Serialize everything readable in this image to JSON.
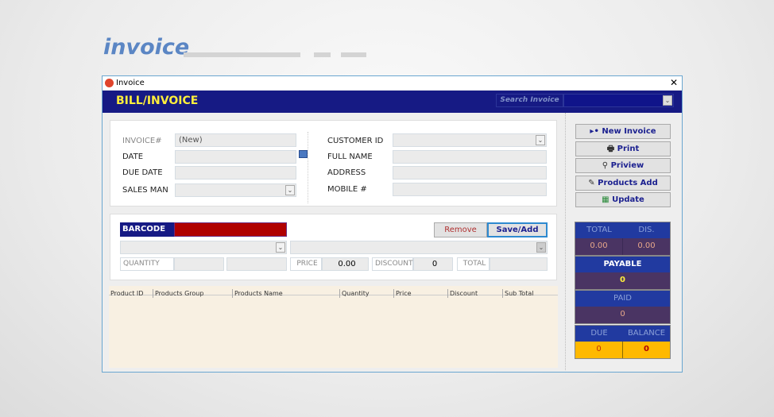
{
  "brand": {
    "title": "invoice"
  },
  "window": {
    "title": "Invoice",
    "close": "✕"
  },
  "header": {
    "title": "BILL/INVOICE",
    "search_label": "Search Invoice",
    "search_value": ""
  },
  "form": {
    "invoice_label": "INVOICE#",
    "invoice_value": "(New)",
    "date_label": "DATE",
    "due_date_label": "DUE DATE",
    "sales_man_label": "SALES MAN",
    "customer_id_label": "CUSTOMER ID",
    "full_name_label": "FULL NAME",
    "address_label": "ADDRESS",
    "mobile_label": "MOBILE #"
  },
  "item": {
    "barcode_label": "BARCODE",
    "remove": "Remove",
    "save_add": "Save/Add",
    "quantity_label": "QUANTITY",
    "price_label": "PRICE",
    "price_value": "0.00",
    "discount_label": "DISCOUNT",
    "discount_value": "0",
    "total_label": "TOTAL"
  },
  "grid": {
    "columns": [
      "Product ID",
      "Products Group",
      "Products Name",
      "Quantity",
      "Price",
      "Discount",
      "Sub Total"
    ]
  },
  "actions": {
    "new_invoice": "New Invoice",
    "print": "Print",
    "preview": "Priview",
    "products_add": "Products Add",
    "update": "Update"
  },
  "summary": {
    "total_label": "TOTAL",
    "total_value": "0.00",
    "dis_label": "DIS.",
    "dis_value": "0.00",
    "payable_label": "PAYABLE",
    "payable_value": "0",
    "paid_label": "PAID",
    "paid_value": "0",
    "due_label": "DUE",
    "due_value": "0",
    "balance_label": "BALANCE",
    "balance_value": "0"
  },
  "colors": {
    "header": "#161a84",
    "title": "#ffef3c",
    "barcode_field": "#b00000",
    "due_bg": "#ffb900"
  }
}
